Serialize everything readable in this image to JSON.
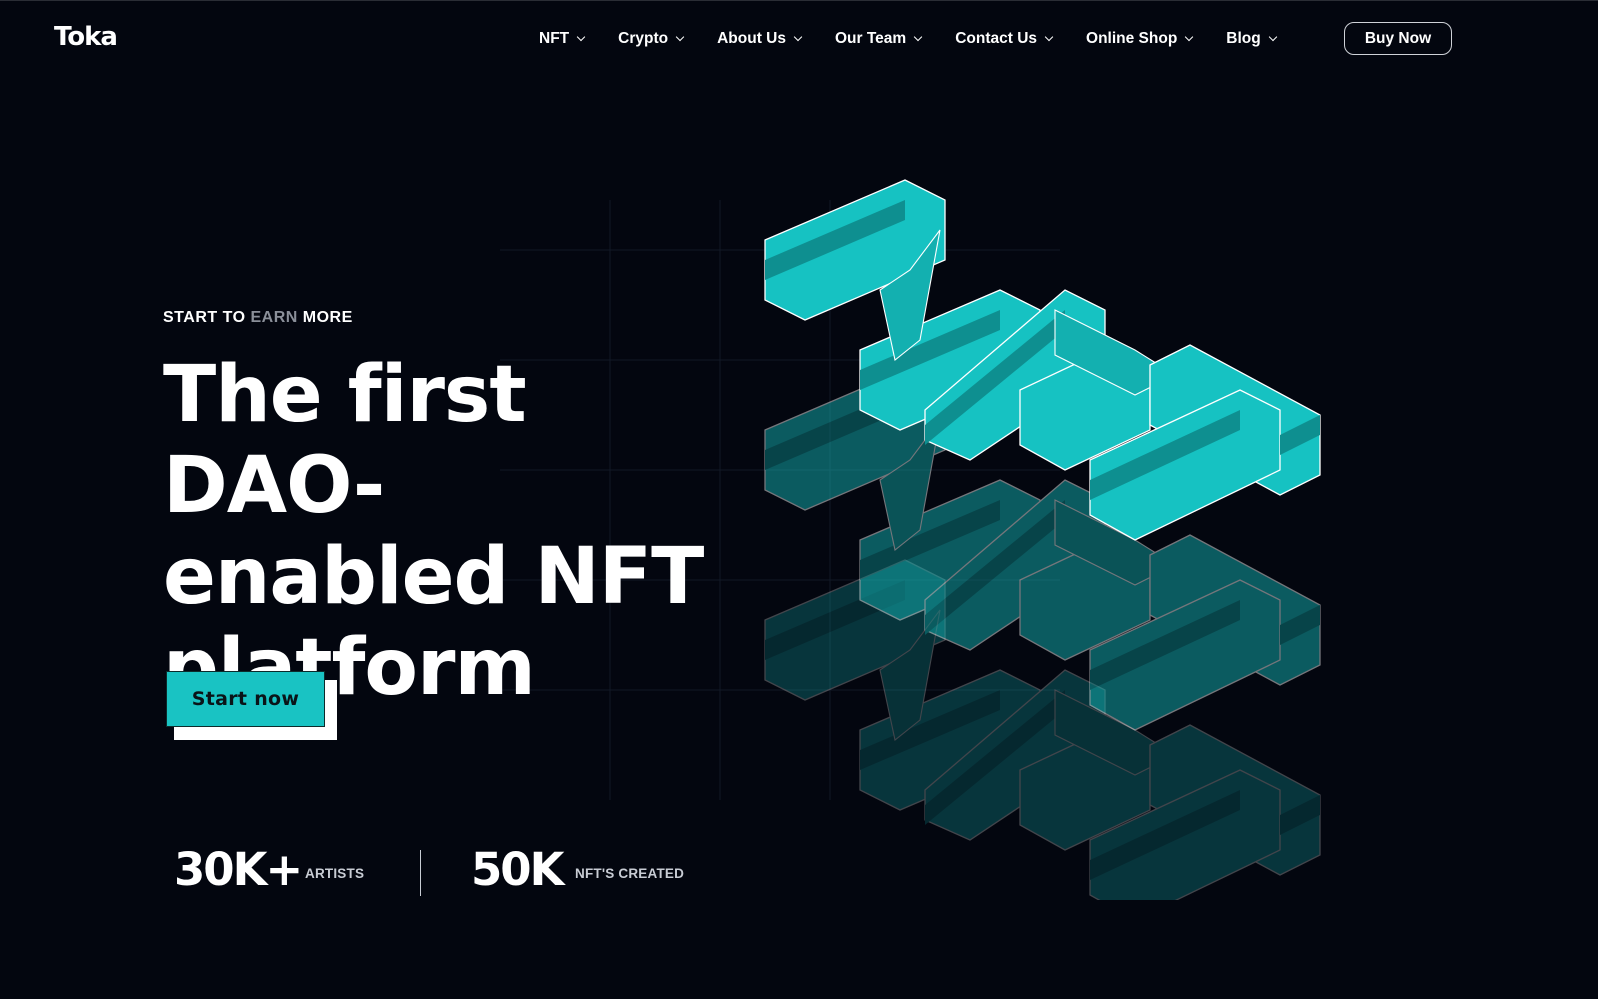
{
  "header": {
    "logo": "Toka",
    "nav": [
      {
        "label": "NFT"
      },
      {
        "label": "Crypto"
      },
      {
        "label": "About Us"
      },
      {
        "label": "Our Team"
      },
      {
        "label": "Contact Us"
      },
      {
        "label": "Online Shop"
      },
      {
        "label": "Blog"
      }
    ],
    "buy_label": "Buy Now"
  },
  "hero": {
    "eyebrow_start": "START",
    "eyebrow_to": "TO",
    "eyebrow_earn": "EARN",
    "eyebrow_more": "MORE",
    "title_line1": "The first DAO-",
    "title_line2": "enabled NFT",
    "title_line3": "platform",
    "cta_label": "Start now"
  },
  "stats": [
    {
      "value": "30K+",
      "label": "ARTISTS"
    },
    {
      "value": "50K",
      "label": "NFT'S CREATED"
    }
  ],
  "colors": {
    "background": "#03060f",
    "accent": "#19c3c3",
    "text": "#ffffff"
  },
  "icons": {
    "nav_caret": "chevron-down-icon"
  }
}
